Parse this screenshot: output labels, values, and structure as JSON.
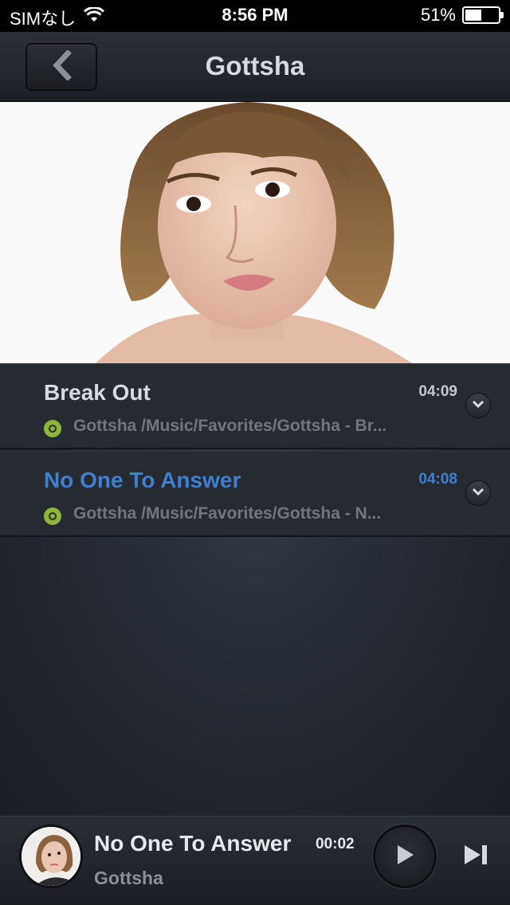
{
  "status_bar": {
    "carrier": "SIMなし",
    "time": "8:56 PM",
    "battery_percent_label": "51%",
    "battery_level": 0.51,
    "icons": [
      "wifi-icon",
      "battery-icon"
    ]
  },
  "nav": {
    "title": "Gottsha",
    "back_icon": "chevron-left-icon"
  },
  "hero": {
    "image": "artist-photo"
  },
  "tracks": [
    {
      "title": "Break Out",
      "duration": "04:09",
      "path": "Gottsha /Music/Favorites/Gottsha - Br...",
      "active": false
    },
    {
      "title": "No One To Answer",
      "duration": "04:08",
      "path": "Gottsha /Music/Favorites/Gottsha - N...",
      "active": true
    }
  ],
  "player": {
    "title": "No One To Answer",
    "elapsed": "00:02",
    "artist": "Gottsha",
    "icons": [
      "play-icon",
      "next-track-icon"
    ]
  },
  "colors": {
    "accent": "#3f7fd1",
    "source_icon": "#8fb33d"
  }
}
